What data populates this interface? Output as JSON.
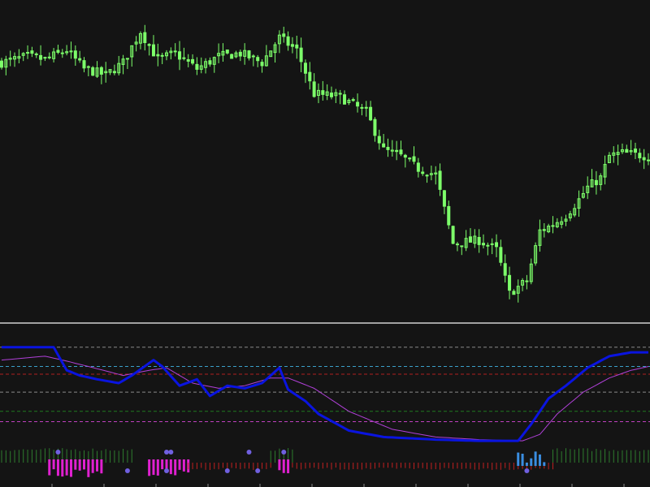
{
  "colors": {
    "background": "#141414",
    "candle_up": "#7dff6a",
    "candle_down": "#7dff6a",
    "separator": "#d0d0d0",
    "oscillator_main": "#0a14e0",
    "oscillator_signal": "#b040d8",
    "histogram_green": "#2e7d2e",
    "histogram_magenta": "#e020d0",
    "histogram_red": "#c02020",
    "histogram_blue": "#3a8de0",
    "dots": "#7060e0",
    "level_gray": "#8a8a8a",
    "level_cyan": "#3aa0c8",
    "level_red": "#b02020",
    "level_green": "#1e7a1e",
    "level_magenta": "#c040c0"
  },
  "chart_data": [
    {
      "type": "candlestick",
      "title": "",
      "xlabel": "",
      "ylabel": "",
      "price_ylim": [
        0,
        100
      ],
      "x_count": 150,
      "close_anchors": [
        [
          0,
          82
        ],
        [
          6,
          84
        ],
        [
          10,
          83
        ],
        [
          15,
          86
        ],
        [
          19,
          80
        ],
        [
          24,
          78
        ],
        [
          28,
          82
        ],
        [
          32,
          92
        ],
        [
          36,
          83
        ],
        [
          40,
          85
        ],
        [
          45,
          80
        ],
        [
          50,
          84
        ],
        [
          55,
          85
        ],
        [
          60,
          82
        ],
        [
          64,
          90
        ],
        [
          68,
          86
        ],
        [
          72,
          72
        ],
        [
          78,
          71
        ],
        [
          84,
          66
        ],
        [
          88,
          54
        ],
        [
          92,
          52
        ],
        [
          96,
          48
        ],
        [
          100,
          46
        ],
        [
          104,
          24
        ],
        [
          110,
          25
        ],
        [
          114,
          22
        ],
        [
          117,
          8
        ],
        [
          121,
          12
        ],
        [
          124,
          28
        ],
        [
          127,
          30
        ],
        [
          130,
          33
        ],
        [
          133,
          38
        ],
        [
          135,
          42
        ],
        [
          138,
          45
        ],
        [
          140,
          52
        ],
        [
          143,
          53
        ],
        [
          149,
          52
        ]
      ],
      "oscillator": {
        "ylim": [
          0,
          100
        ],
        "levels": [
          {
            "value": 90,
            "role": "upper"
          },
          {
            "value": 75,
            "role": "cyan"
          },
          {
            "value": 69,
            "role": "red"
          },
          {
            "value": 55,
            "role": "mid"
          },
          {
            "value": 40,
            "role": "green"
          },
          {
            "value": 32,
            "role": "magenta"
          }
        ],
        "main_line": [
          [
            0,
            90
          ],
          [
            12,
            90
          ],
          [
            15,
            72
          ],
          [
            18,
            68
          ],
          [
            22,
            65
          ],
          [
            27,
            62
          ],
          [
            30,
            68
          ],
          [
            35,
            80
          ],
          [
            37,
            75
          ],
          [
            41,
            60
          ],
          [
            45,
            65
          ],
          [
            48,
            52
          ],
          [
            52,
            60
          ],
          [
            56,
            58
          ],
          [
            60,
            62
          ],
          [
            64,
            74
          ],
          [
            66,
            57
          ],
          [
            70,
            48
          ],
          [
            73,
            38
          ],
          [
            80,
            25
          ],
          [
            88,
            20
          ],
          [
            100,
            18
          ],
          [
            110,
            17
          ],
          [
            119,
            17
          ],
          [
            122,
            30
          ],
          [
            126,
            50
          ],
          [
            130,
            60
          ],
          [
            135,
            74
          ],
          [
            140,
            83
          ],
          [
            145,
            86
          ],
          [
            149,
            86
          ]
        ],
        "signal_line": [
          [
            0,
            80
          ],
          [
            10,
            83
          ],
          [
            14,
            80
          ],
          [
            20,
            75
          ],
          [
            28,
            68
          ],
          [
            34,
            72
          ],
          [
            38,
            74
          ],
          [
            44,
            62
          ],
          [
            50,
            58
          ],
          [
            56,
            60
          ],
          [
            62,
            66
          ],
          [
            66,
            66
          ],
          [
            72,
            58
          ],
          [
            80,
            40
          ],
          [
            90,
            26
          ],
          [
            100,
            20
          ],
          [
            110,
            18
          ],
          [
            120,
            17
          ],
          [
            124,
            22
          ],
          [
            128,
            38
          ],
          [
            134,
            55
          ],
          [
            140,
            66
          ],
          [
            145,
            72
          ],
          [
            149,
            75
          ]
        ],
        "histogram_segments": [
          {
            "from": 0,
            "to": 30,
            "color": "green"
          },
          {
            "from": 11,
            "to": 23,
            "color": "magenta"
          },
          {
            "from": 34,
            "to": 43,
            "color": "magenta"
          },
          {
            "from": 43,
            "to": 62,
            "color": "red"
          },
          {
            "from": 62,
            "to": 67,
            "color": "green"
          },
          {
            "from": 64,
            "to": 66,
            "color": "magenta"
          },
          {
            "from": 67,
            "to": 127,
            "color": "red"
          },
          {
            "from": 119,
            "to": 125,
            "color": "blue"
          },
          {
            "from": 127,
            "to": 149,
            "color": "green"
          }
        ],
        "dots": [
          [
            13,
            "upper"
          ],
          [
            38,
            "upper"
          ],
          [
            39,
            "upper"
          ],
          [
            57,
            "upper"
          ],
          [
            65,
            "upper"
          ],
          [
            29,
            "lower"
          ],
          [
            38,
            "lower"
          ],
          [
            52,
            "lower"
          ],
          [
            59,
            "lower"
          ],
          [
            121,
            "lower"
          ]
        ]
      }
    }
  ]
}
